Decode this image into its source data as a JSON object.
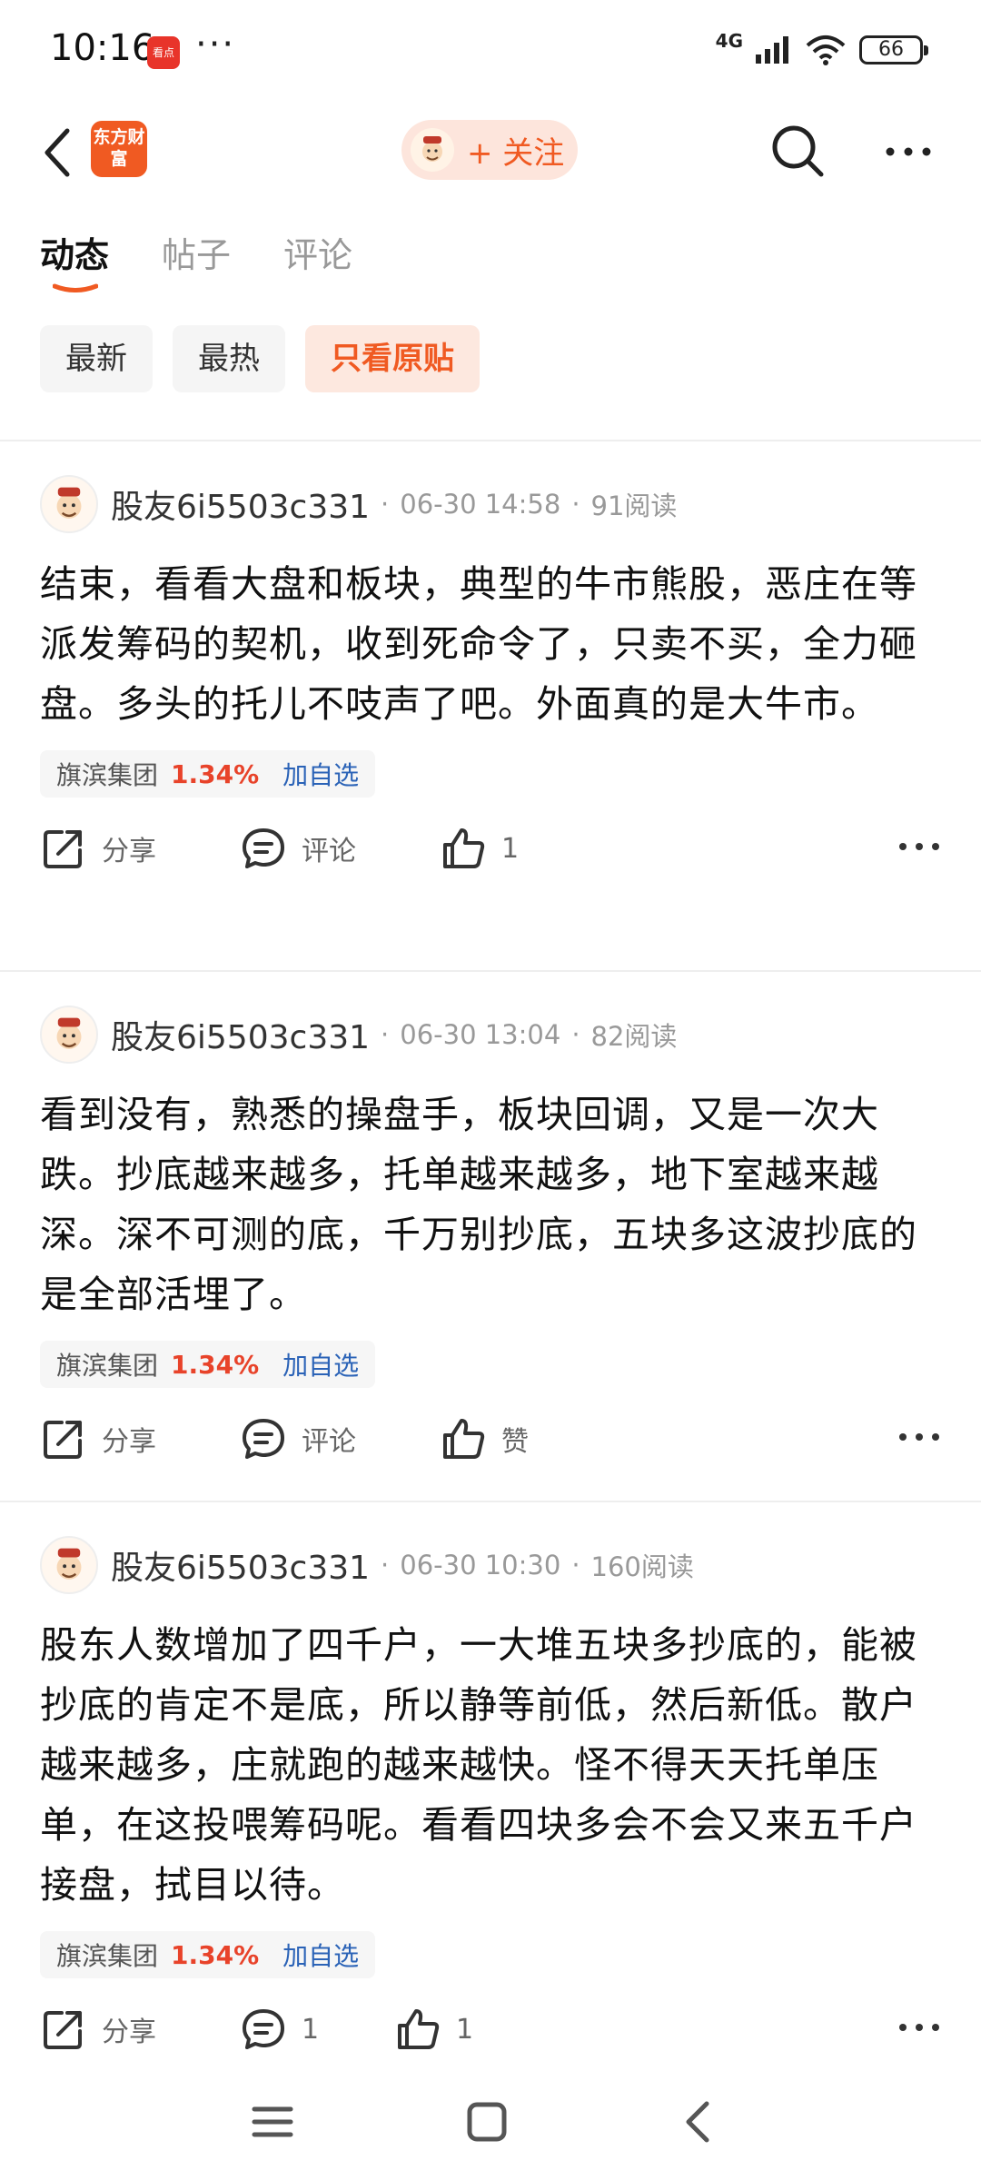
{
  "status_bar": {
    "time": "10:16",
    "app_icon_label": "看点",
    "more": "···",
    "network": "4G",
    "battery": "66"
  },
  "nav": {
    "logo_text": "东方财富",
    "follow_label": "+ 关注"
  },
  "tabs": [
    {
      "label": "动态",
      "active": true
    },
    {
      "label": "帖子",
      "active": false
    },
    {
      "label": "评论",
      "active": false
    }
  ],
  "filters": [
    {
      "label": "最新",
      "active": false
    },
    {
      "label": "最热",
      "active": false
    },
    {
      "label": "只看原贴",
      "active": true
    }
  ],
  "posts": [
    {
      "author": "股友6i5503c331",
      "time": "06-30 14:58",
      "reads": "91阅读",
      "content": "结束，看看大盘和板块，典型的牛市熊股，恶庄在等派发筹码的契机，收到死命令了，只卖不买，全力砸盘。多头的托儿不吱声了吧。外面真的是大牛市。",
      "stock": {
        "name": "旗滨集团",
        "change": "1.34%",
        "add": "加自选"
      },
      "share": "分享",
      "comment": "评论",
      "like": "1"
    },
    {
      "author": "股友6i5503c331",
      "time": "06-30 13:04",
      "reads": "82阅读",
      "content": "看到没有，熟悉的操盘手，板块回调，又是一次大跌。抄底越来越多，托单越来越多，地下室越来越深。深不可测的底，千万别抄底，五块多这波抄底的是全部活埋了。",
      "stock": {
        "name": "旗滨集团",
        "change": "1.34%",
        "add": "加自选"
      },
      "share": "分享",
      "comment": "评论",
      "like": "赞"
    },
    {
      "author": "股友6i5503c331",
      "time": "06-30 10:30",
      "reads": "160阅读",
      "content": "股东人数增加了四千户，一大堆五块多抄底的，能被抄底的肯定不是底，所以静等前低，然后新低。散户越来越多，庄就跑的越来越快。怪不得天天托单压单，在这投喂筹码呢。看看四块多会不会又来五千户接盘，拭目以待。",
      "stock": {
        "name": "旗滨集团",
        "change": "1.34%",
        "add": "加自选"
      },
      "share": "分享",
      "comment": "1",
      "like": "1"
    }
  ],
  "colors": {
    "accent": "#f05a22",
    "stock_up": "#e8432a",
    "link": "#2b63b7"
  }
}
